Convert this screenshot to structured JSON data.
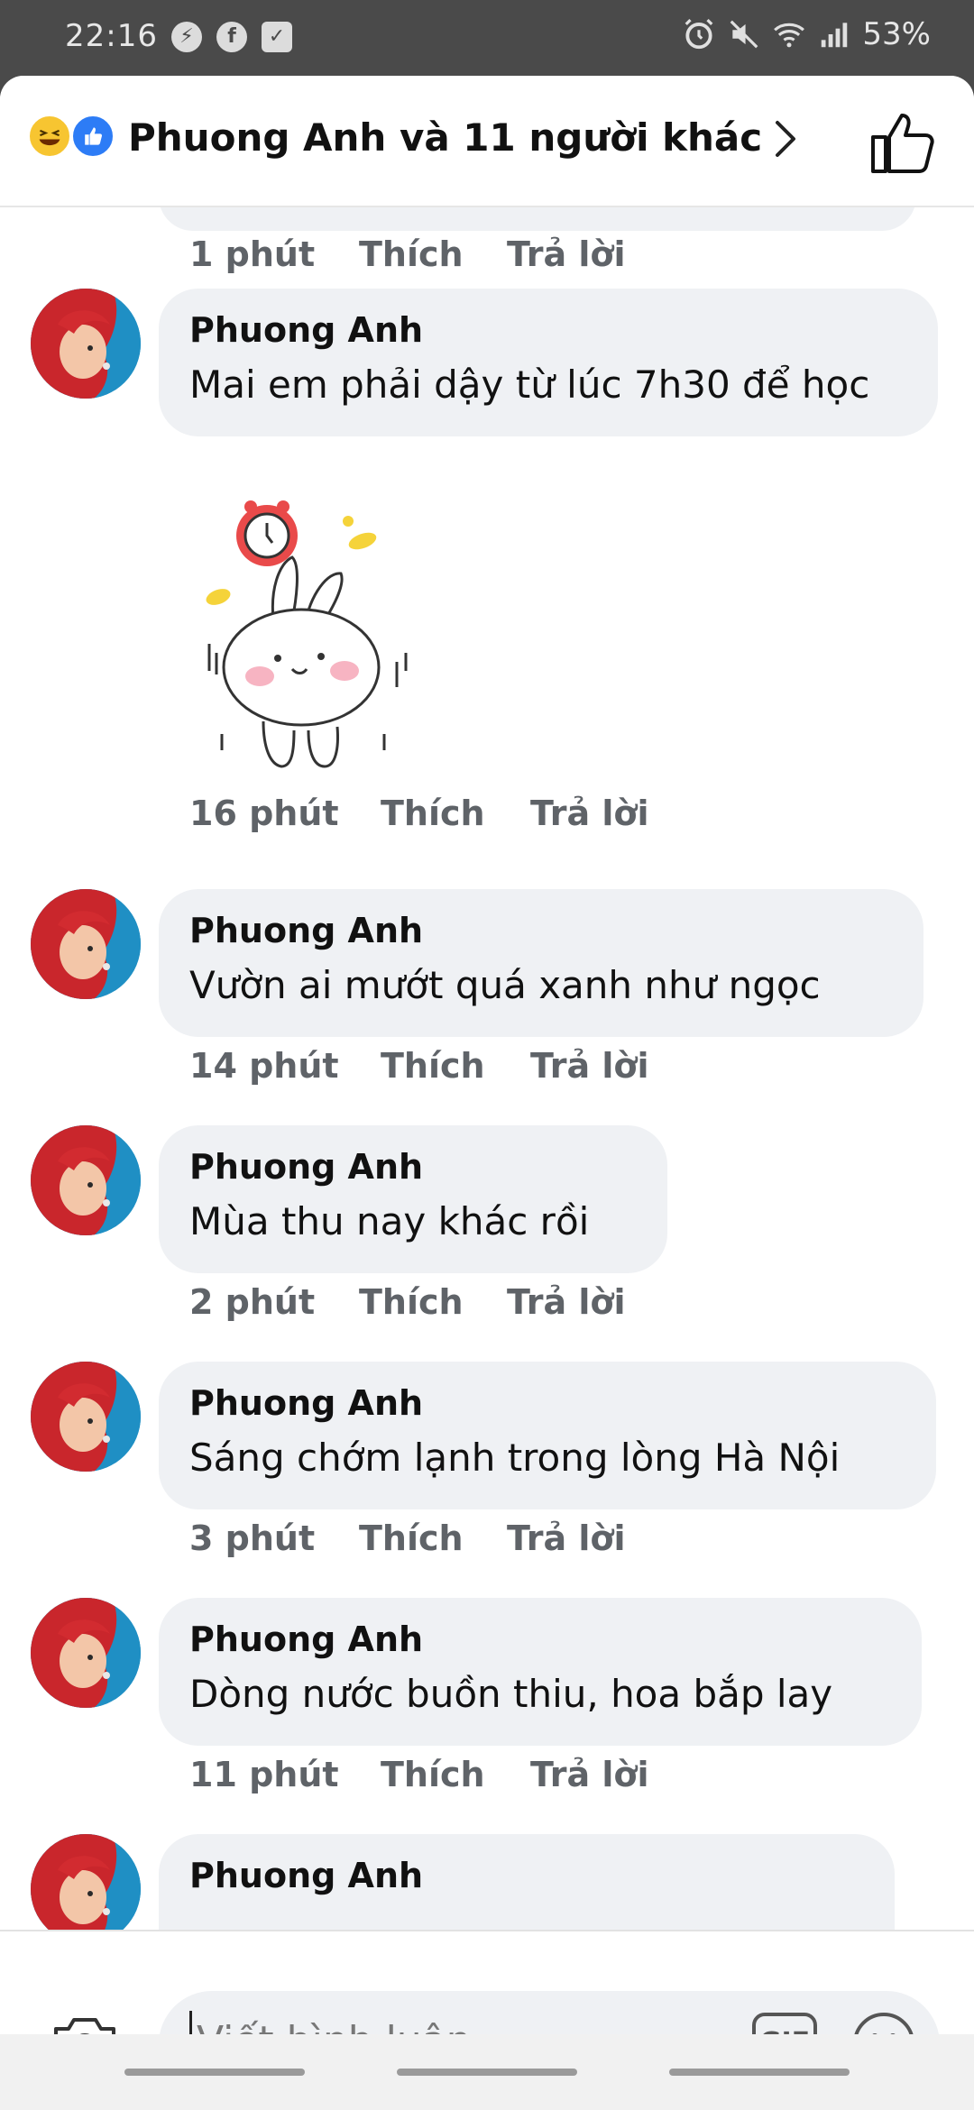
{
  "status_bar": {
    "time": "22:16",
    "battery": "53%",
    "left_icons": [
      "messenger-icon",
      "facebook-icon",
      "checkbox-icon"
    ],
    "right_icons": [
      "alarm-icon",
      "mute-icon",
      "wifi-icon",
      "signal-icon"
    ]
  },
  "header": {
    "title": "Phuong Anh và 11 người khác",
    "reactions": [
      "haha",
      "like"
    ]
  },
  "comments": [
    {
      "name": "",
      "text": "",
      "time": "1 phút",
      "like": "Thích",
      "reply": "Trả lời"
    },
    {
      "name": "Phuong Anh",
      "text": "Mai em phải dậy từ lúc 7h30 để học",
      "time": "16 phút",
      "like": "Thích",
      "reply": "Trả lời",
      "sticker": "bunny-alarm-sticker"
    },
    {
      "name": "Phuong Anh",
      "text": "Vườn ai mướt quá xanh như ngọc",
      "time": "14 phút",
      "like": "Thích",
      "reply": "Trả lời"
    },
    {
      "name": "Phuong Anh",
      "text": "Mùa thu nay khác rồi",
      "time": "2 phút",
      "like": "Thích",
      "reply": "Trả lời"
    },
    {
      "name": "Phuong Anh",
      "text": "Sáng chớm lạnh trong lòng Hà Nội",
      "time": "3 phút",
      "like": "Thích",
      "reply": "Trả lời"
    },
    {
      "name": "Phuong Anh",
      "text": "Dòng nước buồn thiu, hoa bắp lay",
      "time": "11 phút",
      "like": "Thích",
      "reply": "Trả lời"
    },
    {
      "name": "Phuong Anh",
      "text": "",
      "time": "",
      "like": "",
      "reply": ""
    }
  ],
  "composer": {
    "placeholder": "Viết bình luận...",
    "gif_label": "GIF"
  },
  "colors": {
    "bubble": "#eff1f4",
    "like_blue": "#2d7cf6",
    "haha_yellow": "#f7c531",
    "meta_gray": "#5f6368"
  }
}
